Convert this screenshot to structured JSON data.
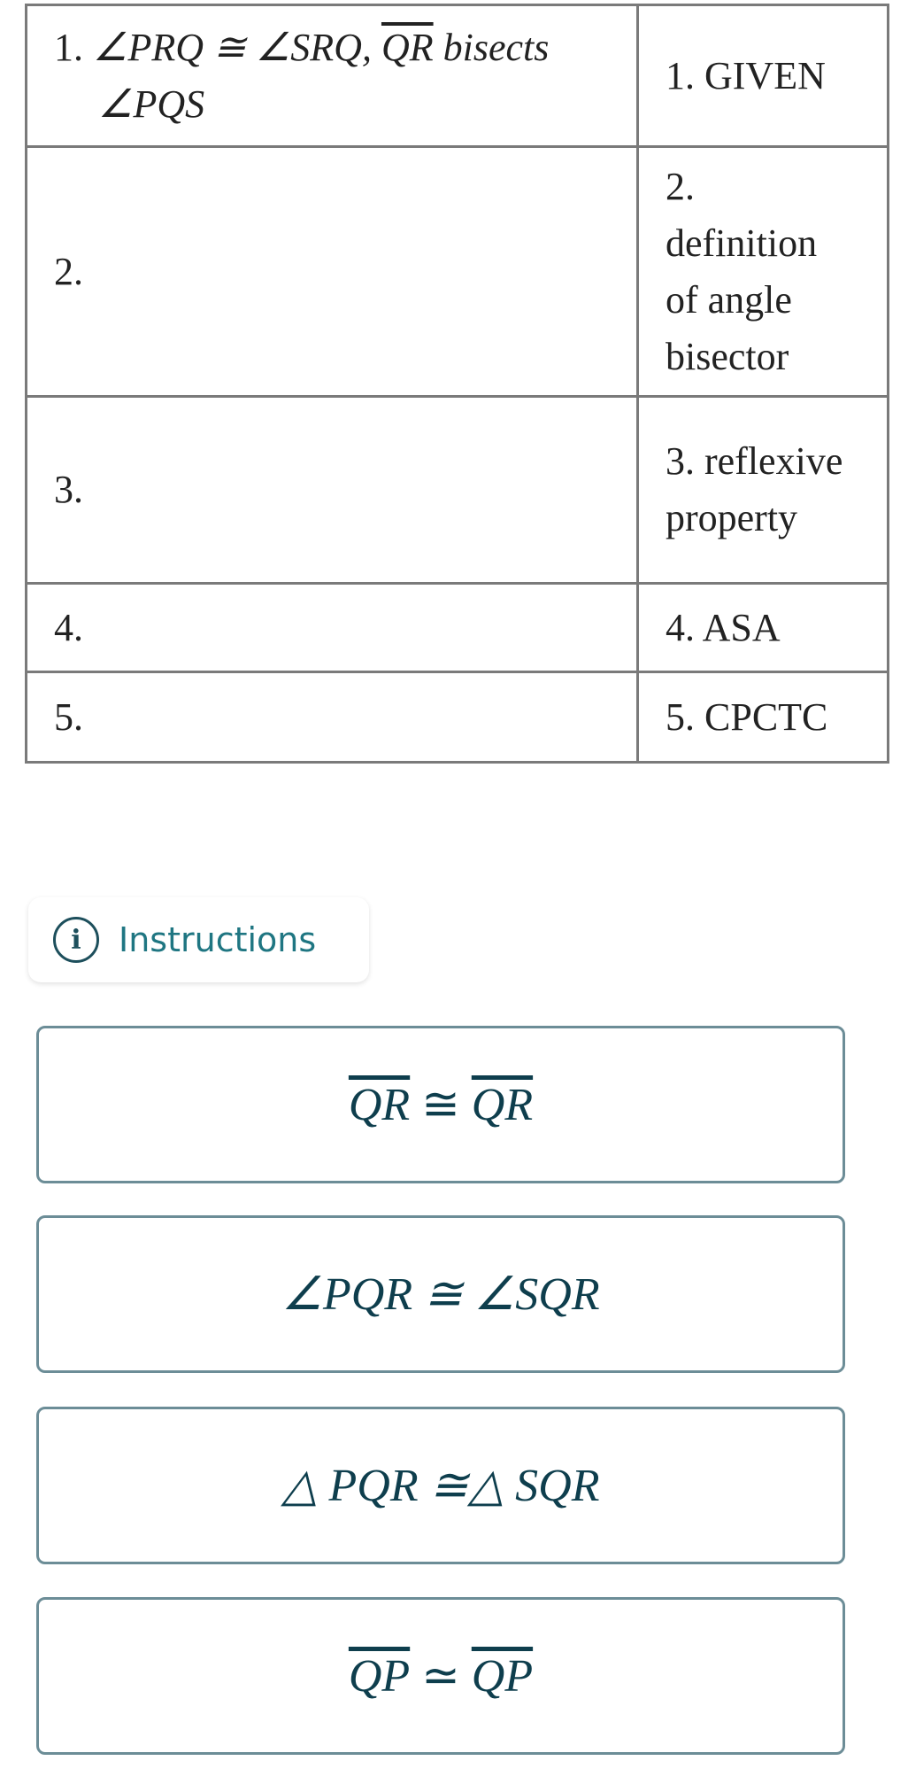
{
  "proof_table": {
    "rows": [
      {
        "statement_prefix": "1. ",
        "statement_math": "∠PRQ ≅ ∠SRQ, ",
        "statement_overline": "QR",
        "statement_suffix": " bisects",
        "statement_line2": "∠PQS",
        "reason": "1. GIVEN"
      },
      {
        "statement": "2.",
        "reason_lines": [
          "2.",
          "definition",
          "of angle",
          "bisector"
        ]
      },
      {
        "statement": "3.",
        "reason_lines": [
          "3. reflexive",
          "property"
        ]
      },
      {
        "statement": "4.",
        "reason": "4. ASA"
      },
      {
        "statement": "5.",
        "reason": "5. CPCTC"
      }
    ]
  },
  "instructions": {
    "label": "Instructions",
    "icon": "info-icon"
  },
  "options": [
    {
      "left": "QR",
      "op": " ≅ ",
      "right": "QR",
      "overline": true
    },
    {
      "text": "∠PQR ≅ ∠SQR"
    },
    {
      "text": "△ PQR ≅△ SQR"
    },
    {
      "left": "QP",
      "op": " ≃ ",
      "right": "QP",
      "overline": true
    }
  ],
  "colors": {
    "accent": "#1f7682",
    "option_text": "#0e3e4d",
    "option_border": "#6c8d97",
    "table_border": "#7a7a7a"
  }
}
